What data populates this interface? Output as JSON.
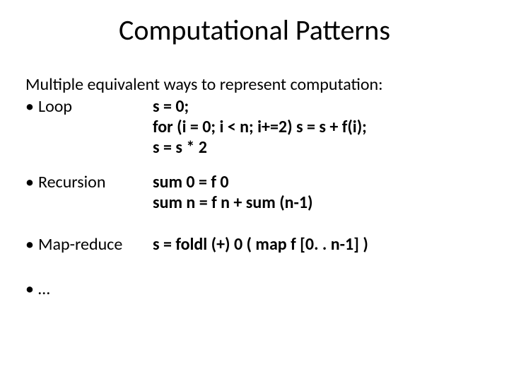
{
  "title": "Computational Patterns",
  "intro": "Multiple equivalent ways to represent computation:",
  "bullet": "•",
  "items": {
    "loop": {
      "label": "Loop",
      "code1": "s = 0;",
      "code2": "for (i = 0; i < n; i+=2)  s = s + f(i);",
      "code3": "s = s * 2"
    },
    "recursion": {
      "label": "Recursion",
      "code1": "sum 0 = f 0",
      "code2": "sum n = f n + sum (n-1)"
    },
    "mapreduce": {
      "label": "Map-reduce",
      "code1": "s = foldl (+) 0 ( map f [0. . n-1] )"
    },
    "ellipsis": {
      "label": "…"
    }
  }
}
